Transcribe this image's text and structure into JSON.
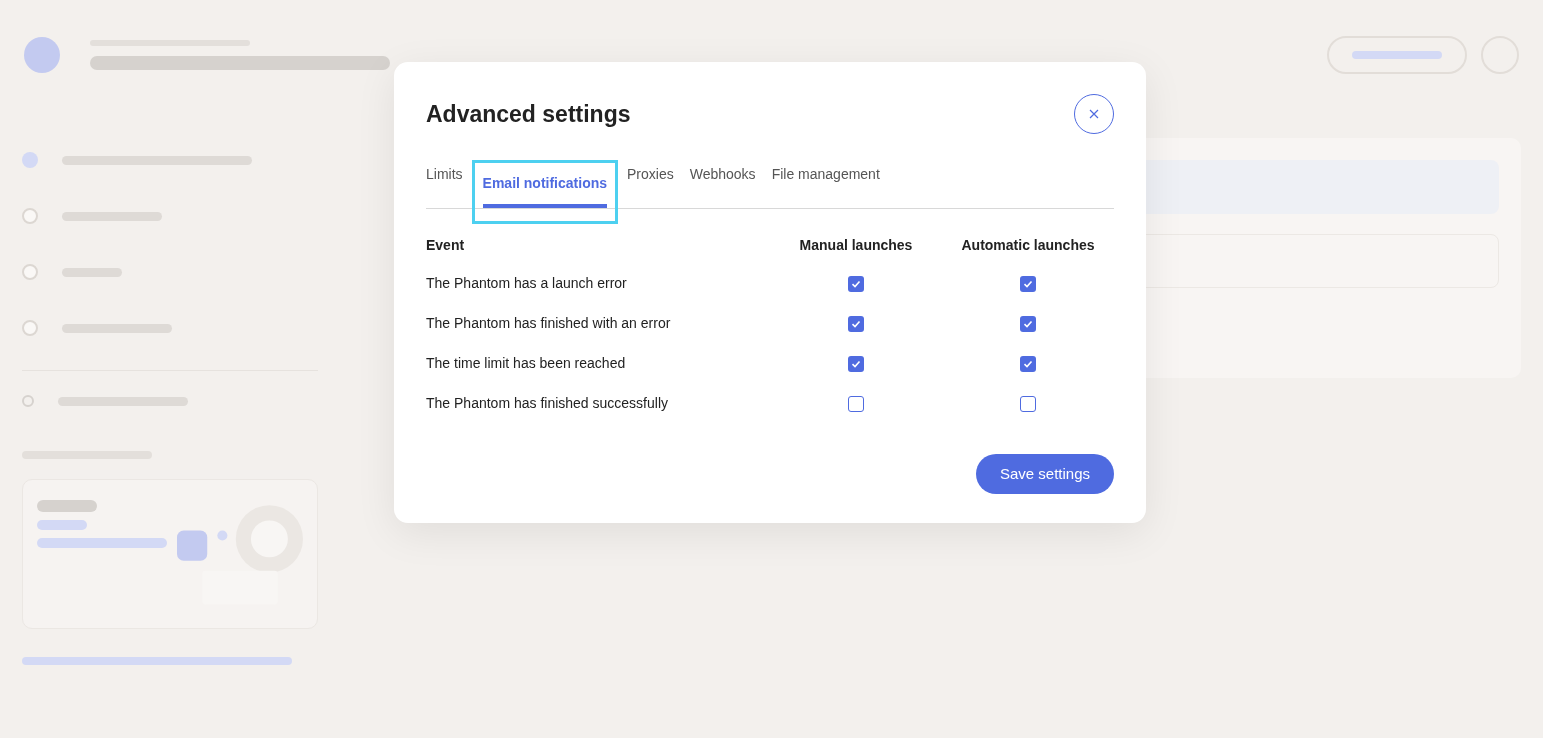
{
  "modal": {
    "title": "Advanced settings",
    "tabs": [
      {
        "label": "Limits",
        "selected": false
      },
      {
        "label": "Email notifications",
        "selected": true
      },
      {
        "label": "Proxies",
        "selected": false
      },
      {
        "label": "Webhooks",
        "selected": false
      },
      {
        "label": "File management",
        "selected": false
      }
    ],
    "columns": [
      "Event",
      "Manual launches",
      "Automatic launches"
    ],
    "rows": [
      {
        "event": "The Phantom has a launch error",
        "manual": true,
        "automatic": true
      },
      {
        "event": "The Phantom has finished with an error",
        "manual": true,
        "automatic": true
      },
      {
        "event": "The time limit has been reached",
        "manual": true,
        "automatic": true
      },
      {
        "event": "The Phantom has finished successfully",
        "manual": false,
        "automatic": false
      }
    ],
    "save": "Save settings"
  }
}
